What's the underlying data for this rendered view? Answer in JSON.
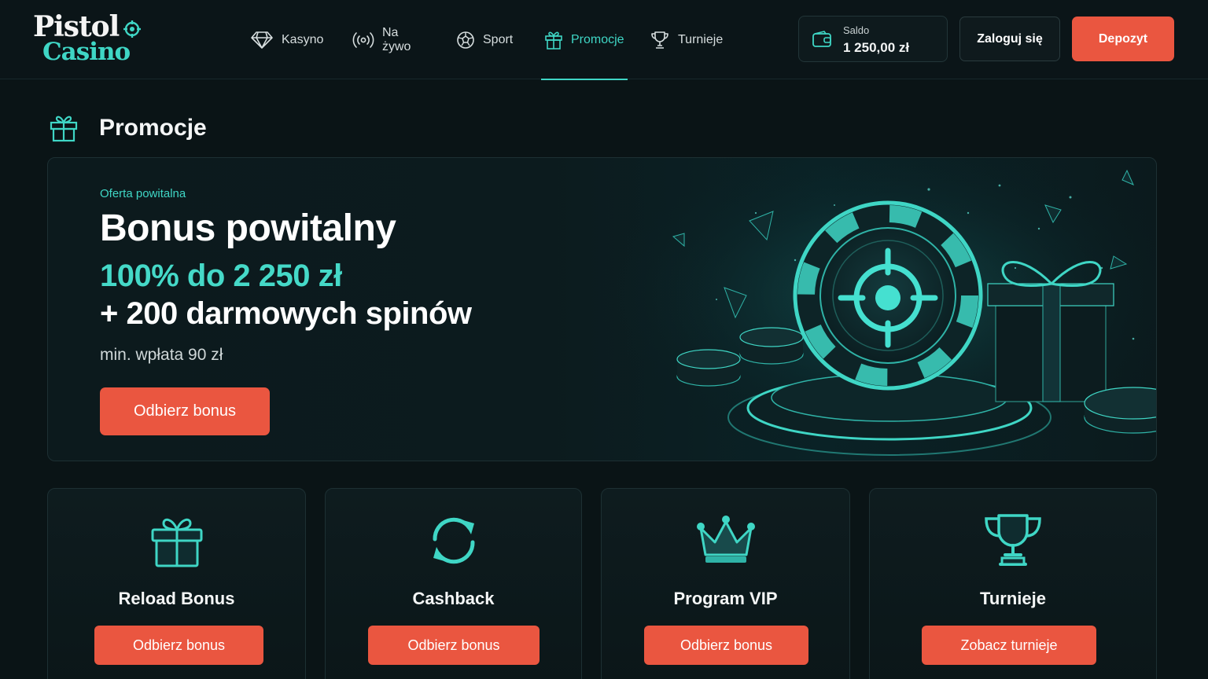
{
  "brand": {
    "line1": "Pistol",
    "line2": "Casino"
  },
  "nav": {
    "items": [
      {
        "label": "Kasyno",
        "icon": "diamond-icon"
      },
      {
        "label": "Na żywo",
        "icon": "live-broadcast-icon"
      },
      {
        "label": "Sport",
        "icon": "ball-icon"
      },
      {
        "label": "Promocje",
        "icon": "gift-icon",
        "active": true
      },
      {
        "label": "Turnieje",
        "icon": "trophy-icon"
      }
    ]
  },
  "balance": {
    "label": "Saldo",
    "value": "1 250,00 zł",
    "icon": "wallet-icon"
  },
  "header_actions": {
    "login": "Zaloguj się",
    "deposit": "Depozyt"
  },
  "page": {
    "title": "Promocje",
    "icon": "gift-icon"
  },
  "hero": {
    "eyebrow": "Oferta powitalna",
    "title": "Bonus powitalny",
    "offer_line1": "100% do 2 250 zł",
    "offer_line2": "+ 200 darmowych spinów",
    "min_deposit": "min. wpłata 90 zł",
    "cta": "Odbierz bonus"
  },
  "cards": [
    {
      "title": "Reload Bonus",
      "button": "Odbierz bonus",
      "icon": "gift-icon"
    },
    {
      "title": "Cashback",
      "button": "Odbierz bonus",
      "icon": "refresh-icon"
    },
    {
      "title": "Program VIP",
      "button": "Odbierz bonus",
      "icon": "crown-icon"
    },
    {
      "title": "Turnieje",
      "button": "Zobacz turnieje",
      "icon": "trophy-icon"
    }
  ],
  "colors": {
    "accent": "#3fd6c5",
    "cta": "#ea5640",
    "background": "#0a1416"
  }
}
